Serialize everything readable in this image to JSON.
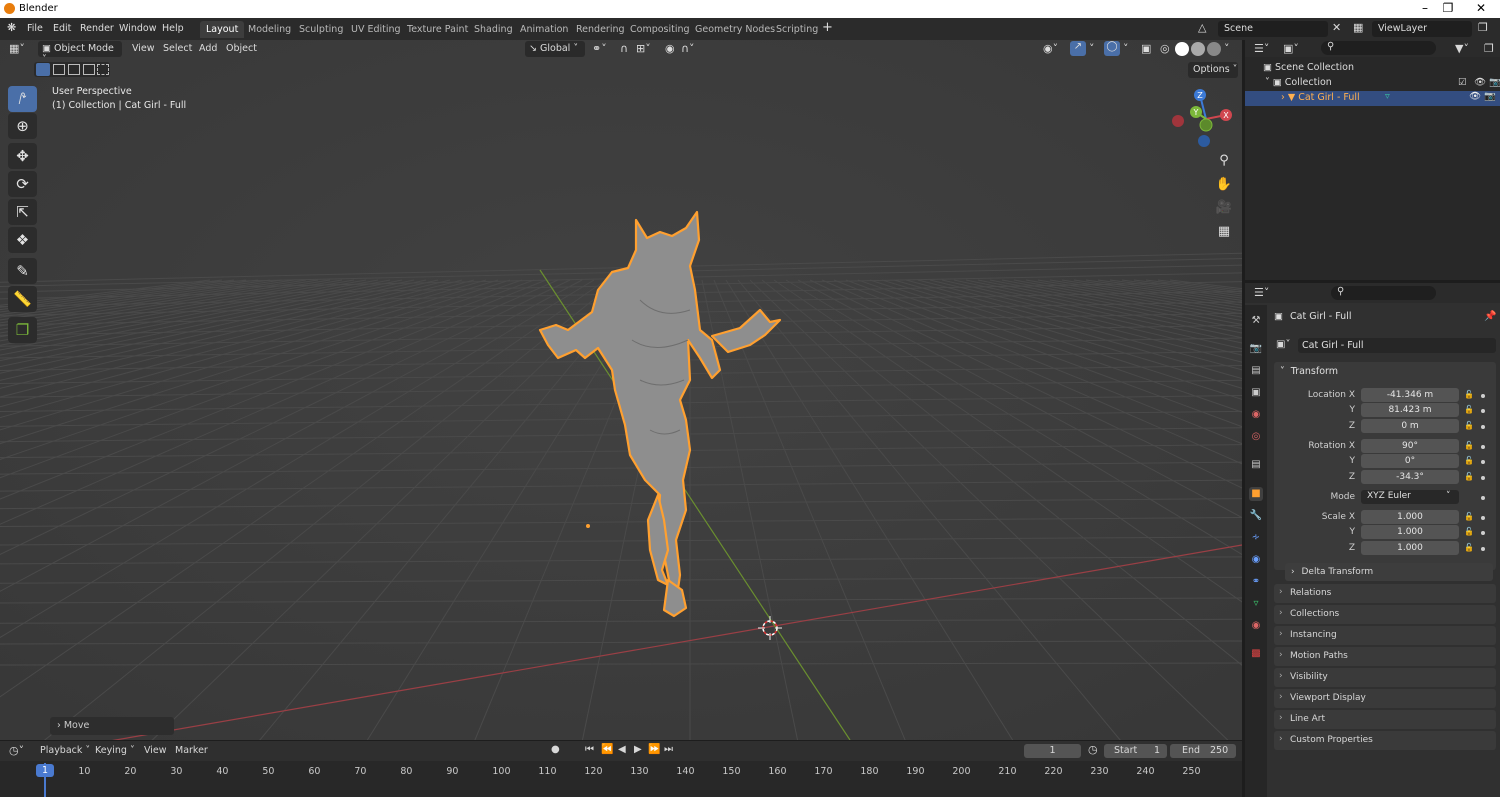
{
  "window": {
    "title": "Blender"
  },
  "menu": {
    "file": "File",
    "edit": "Edit",
    "render": "Render",
    "window": "Window",
    "help": "Help"
  },
  "workspaces": [
    "Layout",
    "Modeling",
    "Sculpting",
    "UV Editing",
    "Texture Paint",
    "Shading",
    "Animation",
    "Rendering",
    "Compositing",
    "Geometry Nodes",
    "Scripting"
  ],
  "active_workspace": "Layout",
  "scene": {
    "name": "Scene",
    "view_layer": "ViewLayer"
  },
  "viewport": {
    "mode": "Object Mode",
    "menus": {
      "view": "View",
      "select": "Select",
      "add": "Add",
      "object": "Object"
    },
    "transform_orientation": "Global",
    "options_label": "Options",
    "overlay_text_line1": "User Perspective",
    "overlay_text_line2": "(1) Collection | Cat Girl - Full",
    "last_operator": "Move",
    "gizmo_axes": {
      "x": "X",
      "y": "Y",
      "z": "Z"
    }
  },
  "outliner": {
    "scene_collection": "Scene Collection",
    "collection": "Collection",
    "object": "Cat Girl - Full"
  },
  "properties": {
    "object_name": "Cat Girl - Full",
    "data_name": "Cat Girl - Full",
    "transform_title": "Transform",
    "location_label": "Location X",
    "y_label": "Y",
    "z_label": "Z",
    "location": {
      "x": "-41.346 m",
      "y": "81.423 m",
      "z": "0 m"
    },
    "rotation_label": "Rotation X",
    "rotation": {
      "x": "90°",
      "y": "0°",
      "z": "-34.3°"
    },
    "mode_label": "Mode",
    "rotation_mode": "XYZ Euler",
    "scale_label": "Scale X",
    "scale": {
      "x": "1.000",
      "y": "1.000",
      "z": "1.000"
    },
    "delta_transform": "Delta Transform",
    "panels": [
      "Relations",
      "Collections",
      "Instancing",
      "Motion Paths",
      "Visibility",
      "Viewport Display",
      "Line Art",
      "Custom Properties"
    ]
  },
  "timeline": {
    "playback": "Playback",
    "keying": "Keying",
    "view": "View",
    "marker": "Marker",
    "current_frame": "1",
    "start_label": "Start",
    "start": "1",
    "end_label": "End",
    "end": "250",
    "ruler": [
      "1",
      "10",
      "20",
      "30",
      "40",
      "50",
      "60",
      "70",
      "80",
      "90",
      "100",
      "110",
      "120",
      "130",
      "140",
      "150",
      "160",
      "170",
      "180",
      "190",
      "200",
      "210",
      "220",
      "230",
      "240",
      "250"
    ]
  },
  "colors": {
    "accent_blue": "#4a6fa8",
    "selection_orange": "#ffa030",
    "x_axis": "#d0474f",
    "y_axis": "#7cb83a",
    "z_axis": "#3c7ad6"
  }
}
